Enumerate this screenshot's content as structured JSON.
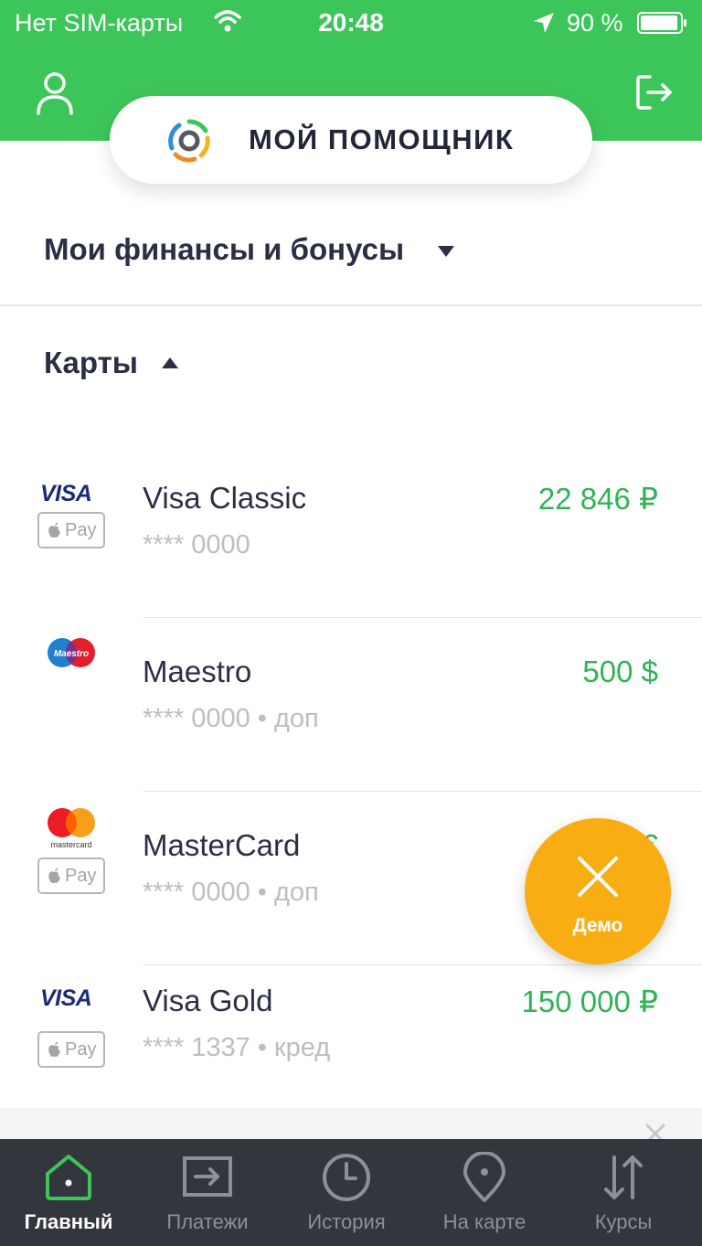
{
  "status_bar": {
    "carrier": "Нет SIM-карты",
    "time": "20:48",
    "battery": "90 %"
  },
  "assistant": {
    "label": "МОЙ ПОМОЩНИК"
  },
  "finances": {
    "title": "Мои финансы и бонусы"
  },
  "cards_section": {
    "title": "Карты"
  },
  "cards": [
    {
      "brand": "VISA",
      "brand_type": "visa",
      "apple_pay": true,
      "apple_pay_label": "Pay",
      "name": "Visa Classic",
      "number": "**** 0000",
      "amount": "22 846 ₽"
    },
    {
      "brand": "Maestro",
      "brand_type": "maestro",
      "apple_pay": false,
      "name": "Maestro",
      "number": "**** 0000 • доп",
      "amount": "500 $"
    },
    {
      "brand": "mastercard",
      "brand_type": "mastercard",
      "apple_pay": true,
      "apple_pay_label": "Pay",
      "name": "MasterCard",
      "number": "**** 0000 • доп",
      "amount": "275 €"
    },
    {
      "brand": "VISA",
      "brand_type": "visa",
      "apple_pay": true,
      "apple_pay_label": "Pay",
      "name": "Visa Gold",
      "number": "**** 1337 • кред",
      "amount": "150 000 ₽"
    }
  ],
  "demo": {
    "label": "Демо"
  },
  "tabs": [
    {
      "label": "Главный",
      "icon": "home-icon",
      "active": true
    },
    {
      "label": "Платежи",
      "icon": "payments-icon",
      "active": false
    },
    {
      "label": "История",
      "icon": "clock-icon",
      "active": false
    },
    {
      "label": "На карте",
      "icon": "map-pin-icon",
      "active": false
    },
    {
      "label": "Курсы",
      "icon": "exchange-arrows-icon",
      "active": false
    }
  ],
  "colors": {
    "brand_green": "#3cc65a",
    "amount_green": "#2fb454",
    "demo_orange": "#f8ad13",
    "tabbar_bg": "#33363d",
    "active_tab_icon": "#3cc65a"
  }
}
